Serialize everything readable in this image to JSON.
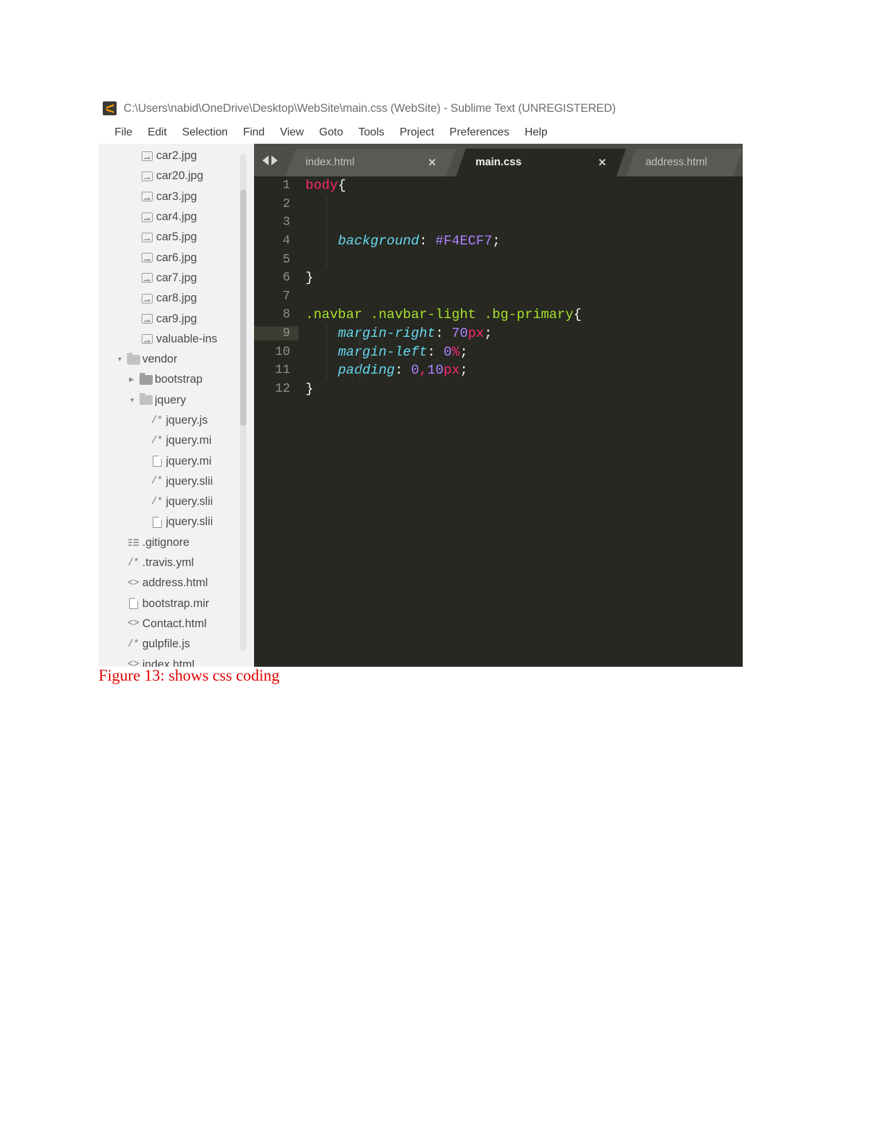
{
  "window": {
    "title": "C:\\Users\\nabid\\OneDrive\\Desktop\\WebSite\\main.css (WebSite) - Sublime Text (UNREGISTERED)",
    "app_icon": "sublime-text-logo-icon"
  },
  "menubar": {
    "items": [
      {
        "label": "File"
      },
      {
        "label": "Edit"
      },
      {
        "label": "Selection"
      },
      {
        "label": "Find"
      },
      {
        "label": "View"
      },
      {
        "label": "Goto"
      },
      {
        "label": "Tools"
      },
      {
        "label": "Project"
      },
      {
        "label": "Preferences"
      },
      {
        "label": "Help"
      }
    ]
  },
  "sidebar": {
    "items": [
      {
        "label": "car2.jpg",
        "icon": "image-file-icon",
        "indent": 1,
        "twisty": ""
      },
      {
        "label": "car20.jpg",
        "icon": "image-file-icon",
        "indent": 1,
        "twisty": ""
      },
      {
        "label": "car3.jpg",
        "icon": "image-file-icon",
        "indent": 1,
        "twisty": ""
      },
      {
        "label": "car4.jpg",
        "icon": "image-file-icon",
        "indent": 1,
        "twisty": ""
      },
      {
        "label": "car5.jpg",
        "icon": "image-file-icon",
        "indent": 1,
        "twisty": ""
      },
      {
        "label": "car6.jpg",
        "icon": "image-file-icon",
        "indent": 1,
        "twisty": ""
      },
      {
        "label": "car7.jpg",
        "icon": "image-file-icon",
        "indent": 1,
        "twisty": ""
      },
      {
        "label": "car8.jpg",
        "icon": "image-file-icon",
        "indent": 1,
        "twisty": ""
      },
      {
        "label": "car9.jpg",
        "icon": "image-file-icon",
        "indent": 1,
        "twisty": ""
      },
      {
        "label": "valuable-ins",
        "icon": "image-file-icon",
        "indent": 1,
        "twisty": ""
      },
      {
        "label": "vendor",
        "icon": "folder-open-icon",
        "indent": 2,
        "twisty": "▼"
      },
      {
        "label": "bootstrap",
        "icon": "folder-closed-icon",
        "indent": 4,
        "twisty": "▶"
      },
      {
        "label": "jquery",
        "icon": "folder-open-icon",
        "indent": 4,
        "twisty": "▼"
      },
      {
        "label": "jquery.js",
        "icon": "comment-file-icon",
        "indent": 3,
        "twisty": ""
      },
      {
        "label": "jquery.mi",
        "icon": "comment-file-icon",
        "indent": 3,
        "twisty": ""
      },
      {
        "label": "jquery.mi",
        "icon": "blank-file-icon",
        "indent": 3,
        "twisty": ""
      },
      {
        "label": "jquery.slii",
        "icon": "comment-file-icon",
        "indent": 3,
        "twisty": ""
      },
      {
        "label": "jquery.slii",
        "icon": "comment-file-icon",
        "indent": 3,
        "twisty": ""
      },
      {
        "label": "jquery.slii",
        "icon": "blank-file-icon",
        "indent": 3,
        "twisty": ""
      },
      {
        "label": ".gitignore",
        "icon": "list-file-icon",
        "indent": 2,
        "twisty": ""
      },
      {
        "label": ".travis.yml",
        "icon": "comment-file-icon",
        "indent": 2,
        "twisty": ""
      },
      {
        "label": "address.html",
        "icon": "code-file-icon",
        "indent": 2,
        "twisty": ""
      },
      {
        "label": "bootstrap.mir",
        "icon": "blank-file-icon",
        "indent": 2,
        "twisty": ""
      },
      {
        "label": "Contact.html",
        "icon": "code-file-icon",
        "indent": 2,
        "twisty": ""
      },
      {
        "label": "gulpfile.js",
        "icon": "comment-file-icon",
        "indent": 2,
        "twisty": ""
      },
      {
        "label": "index.html",
        "icon": "code-file-icon",
        "indent": 2,
        "twisty": ""
      }
    ]
  },
  "tabs": {
    "nav_prev_icon": "arrow-left-icon",
    "nav_next_icon": "arrow-right-icon",
    "close_glyph": "✕",
    "items": [
      {
        "label": "index.html",
        "active": false
      },
      {
        "label": "main.css",
        "active": true
      },
      {
        "label": "address.html",
        "active": false
      }
    ]
  },
  "editor": {
    "lines": [
      {
        "n": "1",
        "current": false
      },
      {
        "n": "2",
        "current": false
      },
      {
        "n": "3",
        "current": false
      },
      {
        "n": "4",
        "current": false
      },
      {
        "n": "5",
        "current": false
      },
      {
        "n": "6",
        "current": false
      },
      {
        "n": "7",
        "current": false
      },
      {
        "n": "8",
        "current": false
      },
      {
        "n": "9",
        "current": true
      },
      {
        "n": "10",
        "current": false
      },
      {
        "n": "11",
        "current": false
      },
      {
        "n": "12",
        "current": false
      }
    ],
    "code": {
      "l1_selector": "body",
      "l1_brace": "{",
      "l4_prop": "background",
      "l4_colon": ": ",
      "l4_value": "#F4ECF7",
      "l4_semi": ";",
      "l6_brace": "}",
      "l8_selector": ".navbar .navbar-light .bg-primary",
      "l8_brace": "{",
      "l9_prop": "margin-right",
      "l9_colon": ": ",
      "l9_num": "70",
      "l9_unit": "px",
      "l9_semi": ";",
      "l10_prop": "margin-left",
      "l10_colon": ": ",
      "l10_num": "0",
      "l10_unit": "%",
      "l10_semi": ";",
      "l11_prop": "padding",
      "l11_colon": ": ",
      "l11_num_a": "0",
      "l11_comma": ",",
      "l11_num_b": "10",
      "l11_unit": "px",
      "l11_semi": ";",
      "l12_brace": "}"
    },
    "colors": {
      "background": "#272822",
      "selector": "#a6e22e",
      "tag": "#f92672",
      "property": "#66d9ef",
      "number": "#ae81ff",
      "unit": "#f92672",
      "plain": "#f8f8f2",
      "gutter": "#90918b",
      "current_line": "#3e3d32"
    }
  },
  "caption": {
    "text": "Figure 13: shows css coding",
    "color": "#e00000"
  }
}
